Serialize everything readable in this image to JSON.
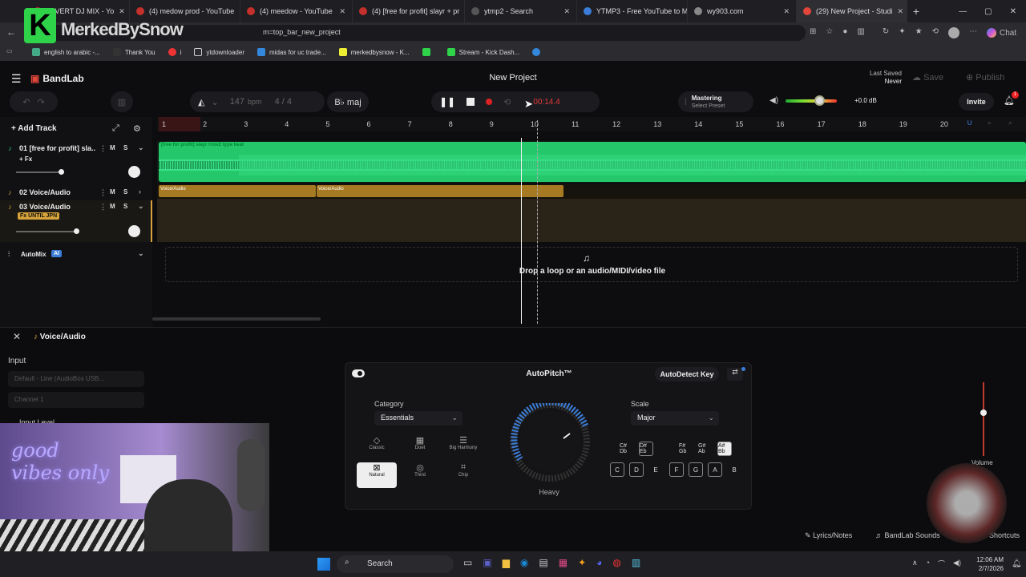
{
  "browser": {
    "tabs": [
      {
        "label": "ZI VERT DJ MIX - Yo",
        "color": "#c4302b"
      },
      {
        "label": "(4) medow prod - YouTube",
        "color": "#c4302b"
      },
      {
        "label": "(4) meedow - YouTube",
        "color": "#c4302b"
      },
      {
        "label": "(4) [free for profit] slayr + pr",
        "color": "#c4302b"
      },
      {
        "label": "ytmp2 - Search",
        "color": "#666"
      },
      {
        "label": "YTMP3 - Free YouTube to M",
        "color": "#3b7dd8"
      },
      {
        "label": "wy903.com",
        "color": "#888"
      },
      {
        "label": "(29) New Project - Studi",
        "color": "#e0463a"
      }
    ],
    "url": "m=top_bar_new_project",
    "overlay_text": "MerkedBySnow",
    "bookmarks": [
      "english to arabic -...",
      "Thank You",
      "i",
      "ytdownloader",
      "midas for uc trade...",
      "merkedbysnow - K...",
      "Stream - Kick Dash..."
    ],
    "chat_label": "Chat"
  },
  "app": {
    "brand": "BandLab",
    "project_title": "New Project",
    "last_saved_label": "Last Saved",
    "last_saved_value": "Never",
    "save_label": "Save",
    "publish_label": "Publish",
    "bpm": "147",
    "bpm_unit": "bpm",
    "time_sig": "4 / 4",
    "key": "B♭ maj",
    "time": "00:14.4",
    "mastering_label": "Mastering",
    "mastering_preset": "Select Preset",
    "volume_db": "+0.0 dB",
    "invite_label": "Invite",
    "notification_count": "1",
    "add_track_label": "Add Track",
    "ruler": [
      "1",
      "2",
      "3",
      "4",
      "5",
      "6",
      "7",
      "8",
      "9",
      "10",
      "11",
      "12",
      "13",
      "14",
      "15",
      "16",
      "17",
      "18",
      "19",
      "20"
    ],
    "tracks": [
      {
        "label": "01 [free for profit] sla...",
        "fx": "+ Fx",
        "region": "[free for profit] slayr  rnxv2 type beat"
      },
      {
        "label": "02 Voice/Audio",
        "region_a": "Voice/Audio",
        "region_b": "Voice/Audio"
      },
      {
        "label": "03 Voice/Audio",
        "fx": "Fx UNTIL JPN"
      }
    ],
    "mute": "M",
    "solo": "S",
    "automix_label": "AutoMix",
    "automix_badge": "AI",
    "drop_text": "Drop a loop or an audio/MIDI/video file"
  },
  "panel": {
    "title": "Voice/Audio",
    "input_label": "Input",
    "input_device": "Default - Line (AudioBox USB...",
    "channel": "Channel 1",
    "input_level_label": "Input Level",
    "autopitch_title": "AutoPitch™",
    "autodetect_label": "AutoDetect Key",
    "category_label": "Category",
    "category_value": "Essentials",
    "voices": [
      "Classic",
      "Duet",
      "Big Harmony",
      "Natural",
      "Third",
      "Chip"
    ],
    "knob_label": "Heavy",
    "scale_label": "Scale",
    "scale_value": "Major",
    "sharp_keys": [
      "C# Db",
      "D# Eb",
      "F# Gb",
      "G# Ab",
      "A# Bb"
    ],
    "natural_keys": [
      "C",
      "D",
      "E",
      "F",
      "G",
      "A",
      "B"
    ],
    "volume_label": "Volume",
    "lyrics_label": "Lyrics/Notes",
    "sounds_label": "BandLab Sounds",
    "shortcuts_label": "Shortcuts"
  },
  "webcam": {
    "neon_text": "good vibes only"
  },
  "taskbar": {
    "search_label": "Search",
    "time": "12:06 AM",
    "date": "2/7/2026"
  }
}
